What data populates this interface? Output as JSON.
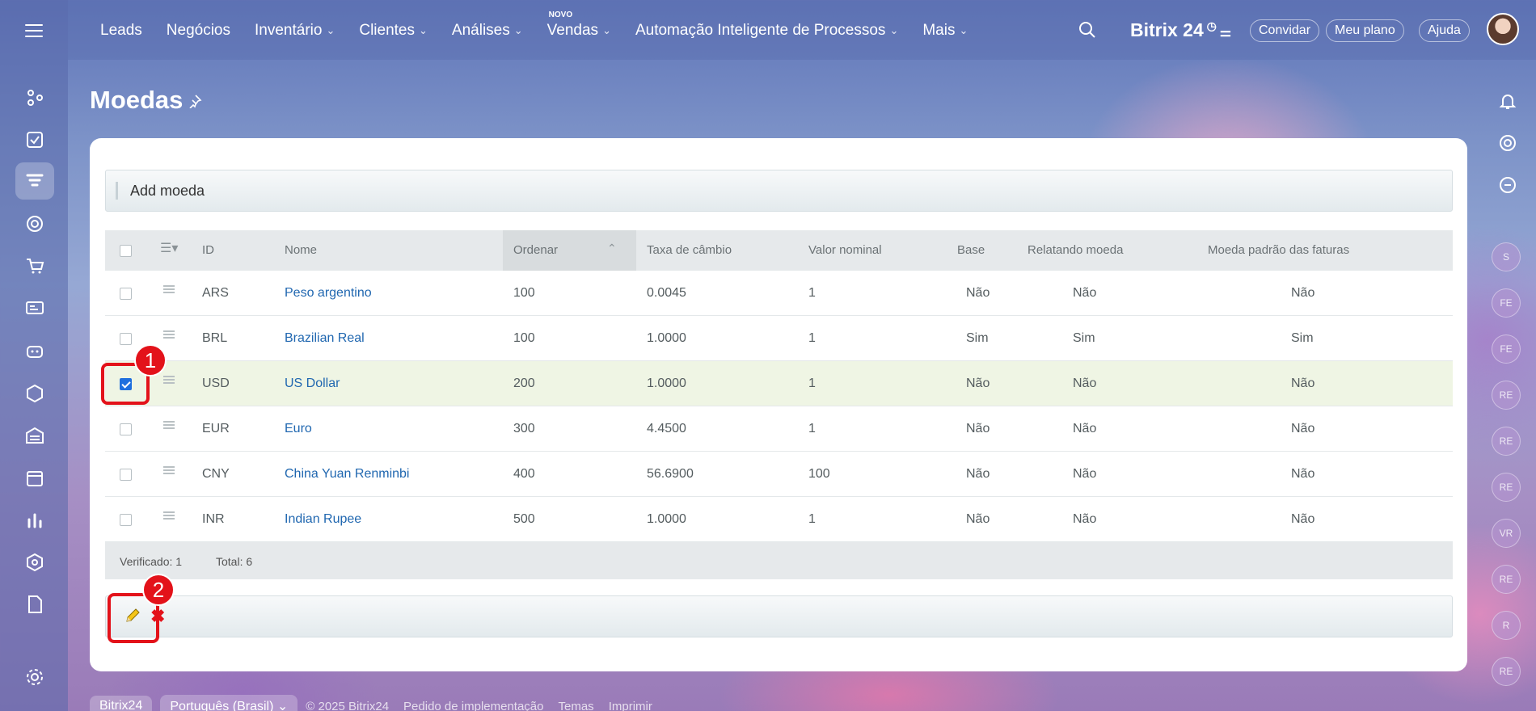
{
  "topnav": {
    "items": [
      {
        "label": "Leads",
        "has_menu": false
      },
      {
        "label": "Negócios",
        "has_menu": false
      },
      {
        "label": "Inventário",
        "has_menu": true
      },
      {
        "label": "Clientes",
        "has_menu": true
      },
      {
        "label": "Análises",
        "has_menu": true
      },
      {
        "label": "Vendas",
        "has_menu": true,
        "badge": "NOVO"
      },
      {
        "label": "Automação Inteligente de Processos",
        "has_menu": true
      },
      {
        "label": "Mais",
        "has_menu": true
      }
    ],
    "logo": "Bitrix 24",
    "invite": "Convidar",
    "plan": "Meu plano",
    "help": "Ajuda"
  },
  "page": {
    "title": "Moedas",
    "add_button": "Add moeda"
  },
  "table": {
    "columns": [
      "ID",
      "Nome",
      "Ordenar",
      "Taxa de câmbio",
      "Valor nominal",
      "Base",
      "Relatando moeda",
      "Moeda padrão das faturas"
    ],
    "rows": [
      {
        "id": "ARS",
        "name": "Peso argentino",
        "sort": "100",
        "rate": "0.0045",
        "nominal": "1",
        "base": "Não",
        "reporting": "Não",
        "invoice": "Não",
        "checked": false
      },
      {
        "id": "BRL",
        "name": "Brazilian Real",
        "sort": "100",
        "rate": "1.0000",
        "nominal": "1",
        "base": "Sim",
        "reporting": "Sim",
        "invoice": "Sim",
        "checked": false
      },
      {
        "id": "USD",
        "name": "US Dollar",
        "sort": "200",
        "rate": "1.0000",
        "nominal": "1",
        "base": "Não",
        "reporting": "Não",
        "invoice": "Não",
        "checked": true
      },
      {
        "id": "EUR",
        "name": "Euro",
        "sort": "300",
        "rate": "4.4500",
        "nominal": "1",
        "base": "Não",
        "reporting": "Não",
        "invoice": "Não",
        "checked": false
      },
      {
        "id": "CNY",
        "name": "China Yuan Renminbi",
        "sort": "400",
        "rate": "56.6900",
        "nominal": "100",
        "base": "Não",
        "reporting": "Não",
        "invoice": "Não",
        "checked": false
      },
      {
        "id": "INR",
        "name": "Indian Rupee",
        "sort": "500",
        "rate": "1.0000",
        "nominal": "1",
        "base": "Não",
        "reporting": "Não",
        "invoice": "Não",
        "checked": false
      }
    ],
    "footer": {
      "checked": "Verificado: 1",
      "total": "Total: 6"
    }
  },
  "annotations": {
    "step1": "1",
    "step2": "2"
  },
  "right_rail_avatars": [
    "S",
    "FE",
    "FE",
    "RE",
    "RE",
    "RE",
    "VR",
    "RE",
    "R",
    "RE"
  ],
  "bottom": {
    "brand": "Bitrix24",
    "language": "Português (Brasil)",
    "copyright": "© 2025 Bitrix24",
    "links": [
      "Pedido de implementação",
      "Temas",
      "Imprimir"
    ]
  },
  "colors": {
    "accent_link": "#2067b0",
    "highlight_row": "#eff5e4",
    "annotation_red": "#e3121a"
  }
}
